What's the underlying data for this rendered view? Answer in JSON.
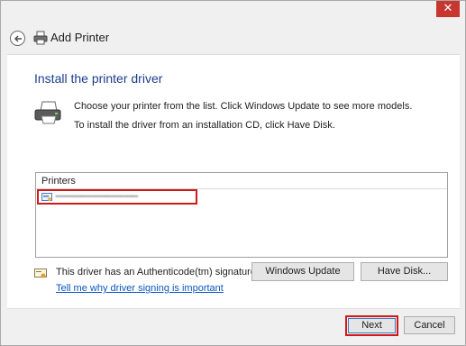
{
  "window": {
    "title": "Add Printer",
    "close_glyph": "✕"
  },
  "page": {
    "heading": "Install the printer driver",
    "desc_line1": "Choose your printer from the list. Click Windows Update to see more models.",
    "desc_line2": "To install the driver from an installation CD, click Have Disk."
  },
  "printers_list": {
    "header": "Printers",
    "items": [
      {
        "label": "▪▪▪▪▪▪▪▪▪▪▪▪▪▪▪▪▪▪▪▪▪▪▪▪▪▪▪▪▪▪▪▪▪▪▪▪",
        "icon": "printer-driver-icon"
      }
    ]
  },
  "signature": {
    "text": "This driver has an Authenticode(tm) signature.",
    "link": "Tell me why driver signing is important",
    "icon": "certificate-icon"
  },
  "buttons": {
    "windows_update": "Windows Update",
    "have_disk": "Have Disk...",
    "next": "Next",
    "cancel": "Cancel"
  },
  "colors": {
    "heading": "#1a3e8c",
    "link": "#0a55c4",
    "highlight": "#d11919",
    "close": "#c7372f"
  }
}
